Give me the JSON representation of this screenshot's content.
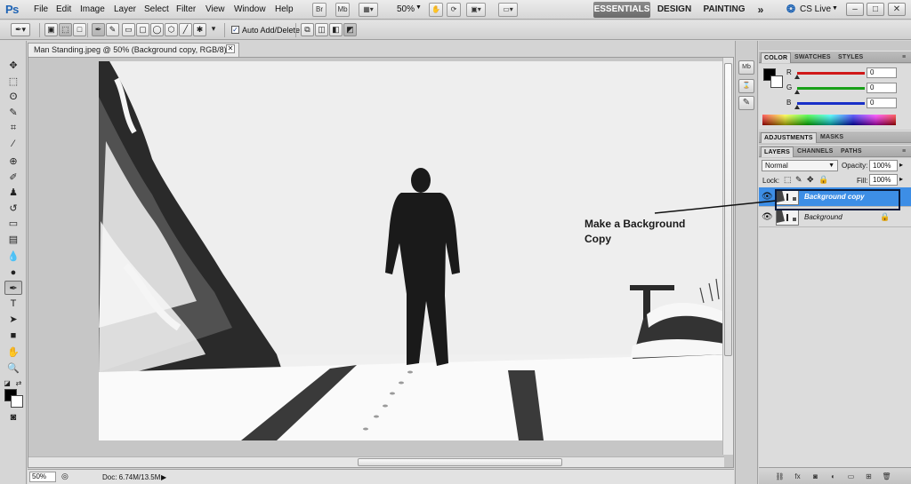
{
  "app": {
    "logo": "Ps",
    "menu": [
      "File",
      "Edit",
      "Image",
      "Layer",
      "Select",
      "Filter",
      "View",
      "Window",
      "Help"
    ],
    "bridge_label": "Br",
    "minibridge_label": "Mb",
    "zoom_dropdown": "50%",
    "workspaces": [
      "ESSENTIALS",
      "DESIGN",
      "PAINTING"
    ],
    "more_workspaces": "»",
    "cs_live": "CS Live",
    "window_controls": [
      "–",
      "□",
      "✕"
    ]
  },
  "options_bar": {
    "auto_add_delete_label": "Auto Add/Delete",
    "auto_add_delete_checked": true
  },
  "tools": [
    {
      "name": "move-tool",
      "glyph": "✥"
    },
    {
      "name": "marquee-tool",
      "glyph": "⬚"
    },
    {
      "name": "lasso-tool",
      "glyph": "ʘ"
    },
    {
      "name": "quick-selection-tool",
      "glyph": "✎"
    },
    {
      "name": "crop-tool",
      "glyph": "⌗"
    },
    {
      "name": "eyedropper-tool",
      "glyph": "⁄"
    },
    {
      "name": "spot-healing-tool",
      "glyph": "⊕"
    },
    {
      "name": "brush-tool",
      "glyph": "✐"
    },
    {
      "name": "clone-stamp-tool",
      "glyph": "♟"
    },
    {
      "name": "history-brush-tool",
      "glyph": "↺"
    },
    {
      "name": "eraser-tool",
      "glyph": "▭"
    },
    {
      "name": "gradient-tool",
      "glyph": "▤"
    },
    {
      "name": "blur-tool",
      "glyph": "💧"
    },
    {
      "name": "dodge-tool",
      "glyph": "●"
    },
    {
      "name": "pen-tool",
      "glyph": "✒"
    },
    {
      "name": "type-tool",
      "glyph": "T"
    },
    {
      "name": "path-selection-tool",
      "glyph": "➤"
    },
    {
      "name": "shape-tool",
      "glyph": "■"
    },
    {
      "name": "hand-tool",
      "glyph": "✋"
    },
    {
      "name": "zoom-tool",
      "glyph": "🔍"
    }
  ],
  "colors": {
    "foreground": "#000000",
    "background": "#ffffff",
    "selected_layer": "#3d8ee6",
    "workspace_active": "#777777"
  },
  "document": {
    "tab_title": "Man Standing.jpeg @ 50% (Background copy, RGB/8) *",
    "annotation": "Make a Background Copy",
    "zoom": "50%",
    "doc_size": "Doc: 6.74M/13.5M"
  },
  "color_panel": {
    "tabs": [
      "COLOR",
      "SWATCHES",
      "STYLES"
    ],
    "channels": [
      {
        "label": "R",
        "value": "0",
        "color": "#d01818"
      },
      {
        "label": "G",
        "value": "0",
        "color": "#18a018"
      },
      {
        "label": "B",
        "value": "0",
        "color": "#1830c8"
      }
    ]
  },
  "adjustments_panel": {
    "tabs": [
      "ADJUSTMENTS",
      "MASKS"
    ]
  },
  "layers_panel": {
    "tabs": [
      "LAYERS",
      "CHANNELS",
      "PATHS"
    ],
    "blend_mode": "Normal",
    "opacity_label": "Opacity:",
    "opacity": "100%",
    "lock_label": "Lock:",
    "fill_label": "Fill:",
    "fill": "100%",
    "layers": [
      {
        "name": "Background copy",
        "selected": true,
        "locked": false
      },
      {
        "name": "Background",
        "selected": false,
        "locked": true
      }
    ],
    "footer_icons": [
      "link-icon",
      "fx-icon",
      "mask-icon",
      "adjustment-icon",
      "group-icon",
      "new-layer-icon",
      "trash-icon"
    ]
  }
}
